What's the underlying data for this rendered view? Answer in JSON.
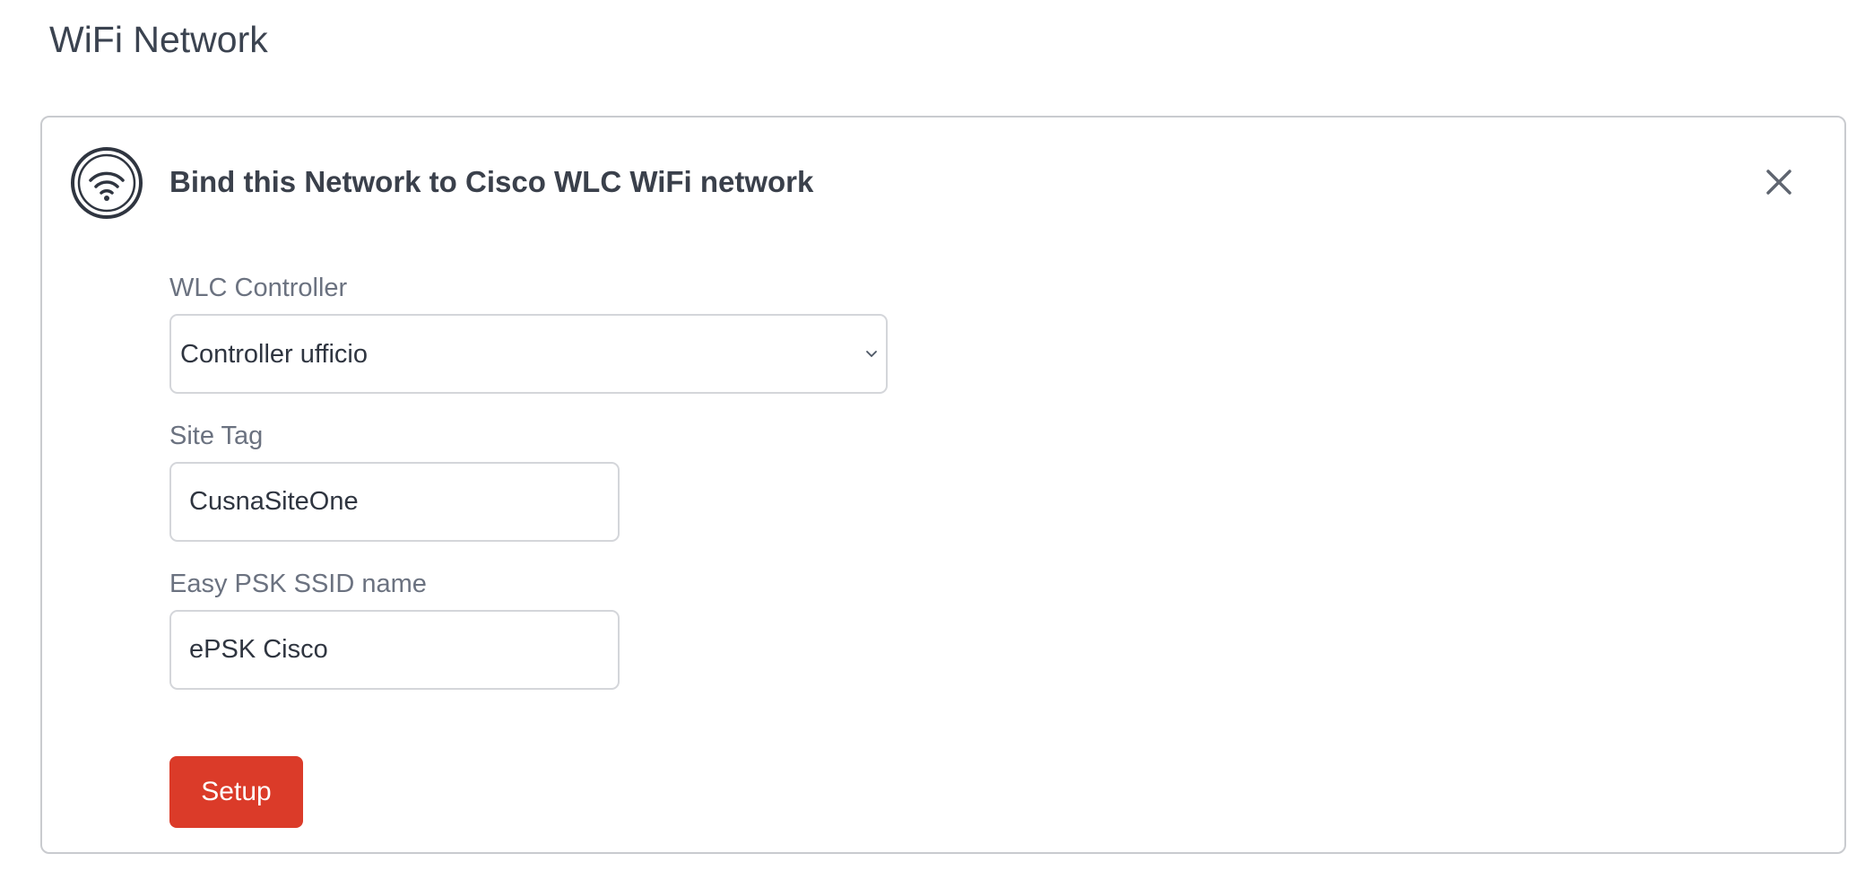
{
  "page": {
    "title": "WiFi Network"
  },
  "card": {
    "title": "Bind this Network to Cisco WLC WiFi network",
    "icon": "wifi-icon",
    "close_icon": "close-icon"
  },
  "form": {
    "controller": {
      "label": "WLC Controller",
      "value": "Controller ufficio"
    },
    "site_tag": {
      "label": "Site Tag",
      "value": "CusnaSiteOne"
    },
    "ssid": {
      "label": "Easy PSK SSID name",
      "value": "ePSK Cisco"
    }
  },
  "actions": {
    "setup_label": "Setup"
  },
  "colors": {
    "primary_button": "#db3b29",
    "border": "#c9cbcf",
    "label": "#6b7280",
    "text": "#3a404b"
  }
}
